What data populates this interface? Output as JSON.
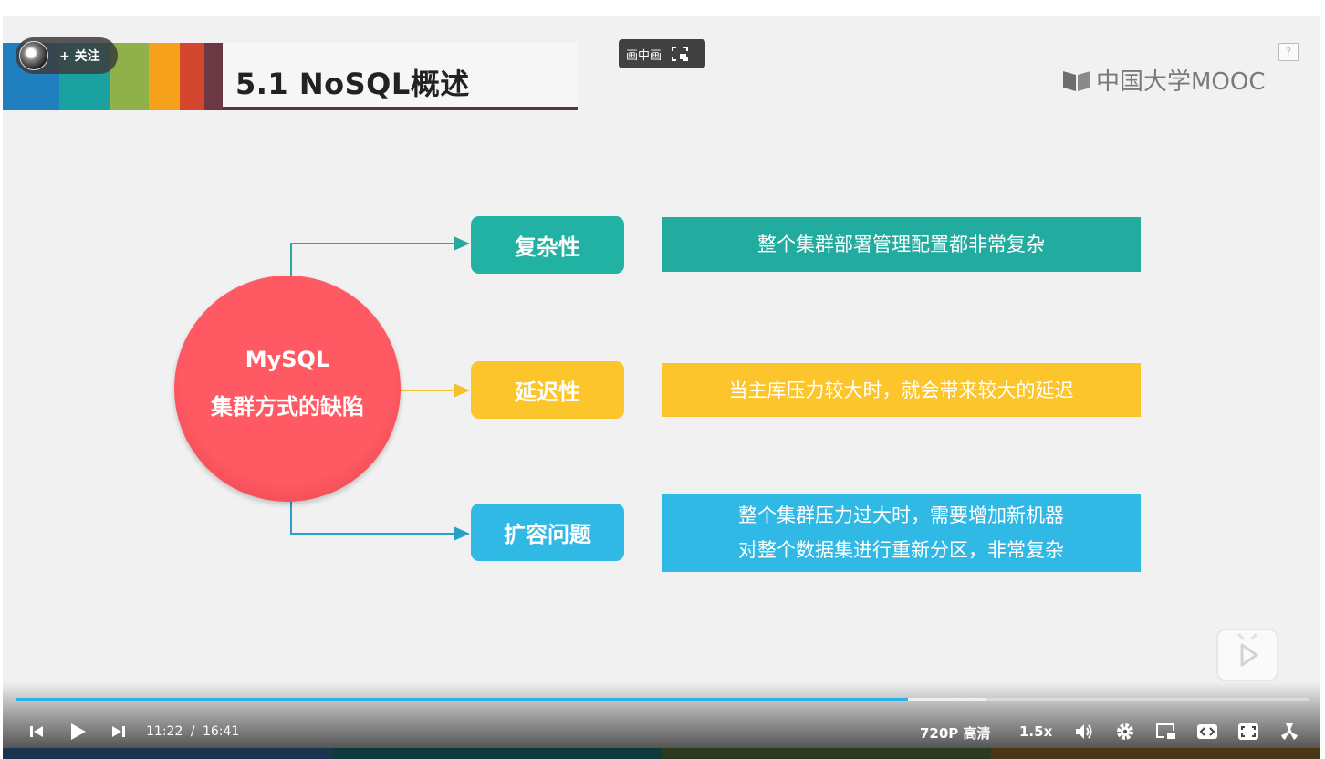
{
  "slide": {
    "title": "5.1 NoSQL概述",
    "logo_text": "中国大学MOOC",
    "help": "?",
    "stripe_colors": [
      "#1f7fbf",
      "#1aa2a0",
      "#8fb04a",
      "#f6a11c",
      "#d5462f",
      "#6b3944"
    ]
  },
  "overlay": {
    "follow_label": "+ 关注",
    "pip_label": "画中画"
  },
  "diagram": {
    "center_line1": "MySQL",
    "center_line2": "集群方式的缺陷",
    "center_color": "#ff5760",
    "items": [
      {
        "label": "复杂性",
        "desc_lines": [
          "整个集群部署管理配置都非常复杂"
        ],
        "color": "#22b2a4"
      },
      {
        "label": "延迟性",
        "desc_lines": [
          "当主库压力较大时，就会带来较大的延迟"
        ],
        "color": "#fcc52c"
      },
      {
        "label": "扩容问题",
        "desc_lines": [
          "整个集群压力过大时，需要增加新机器",
          "对整个数据集进行重新分区，非常复杂"
        ],
        "color": "#31b9e6"
      }
    ]
  },
  "player": {
    "progress_percent": 69,
    "buffered_percent": 75,
    "current_time": "11:22",
    "separator": "/",
    "total_time": "16:41",
    "quality": "720P 高清",
    "speed": "1.5x",
    "accent": "#2bb3e8"
  }
}
